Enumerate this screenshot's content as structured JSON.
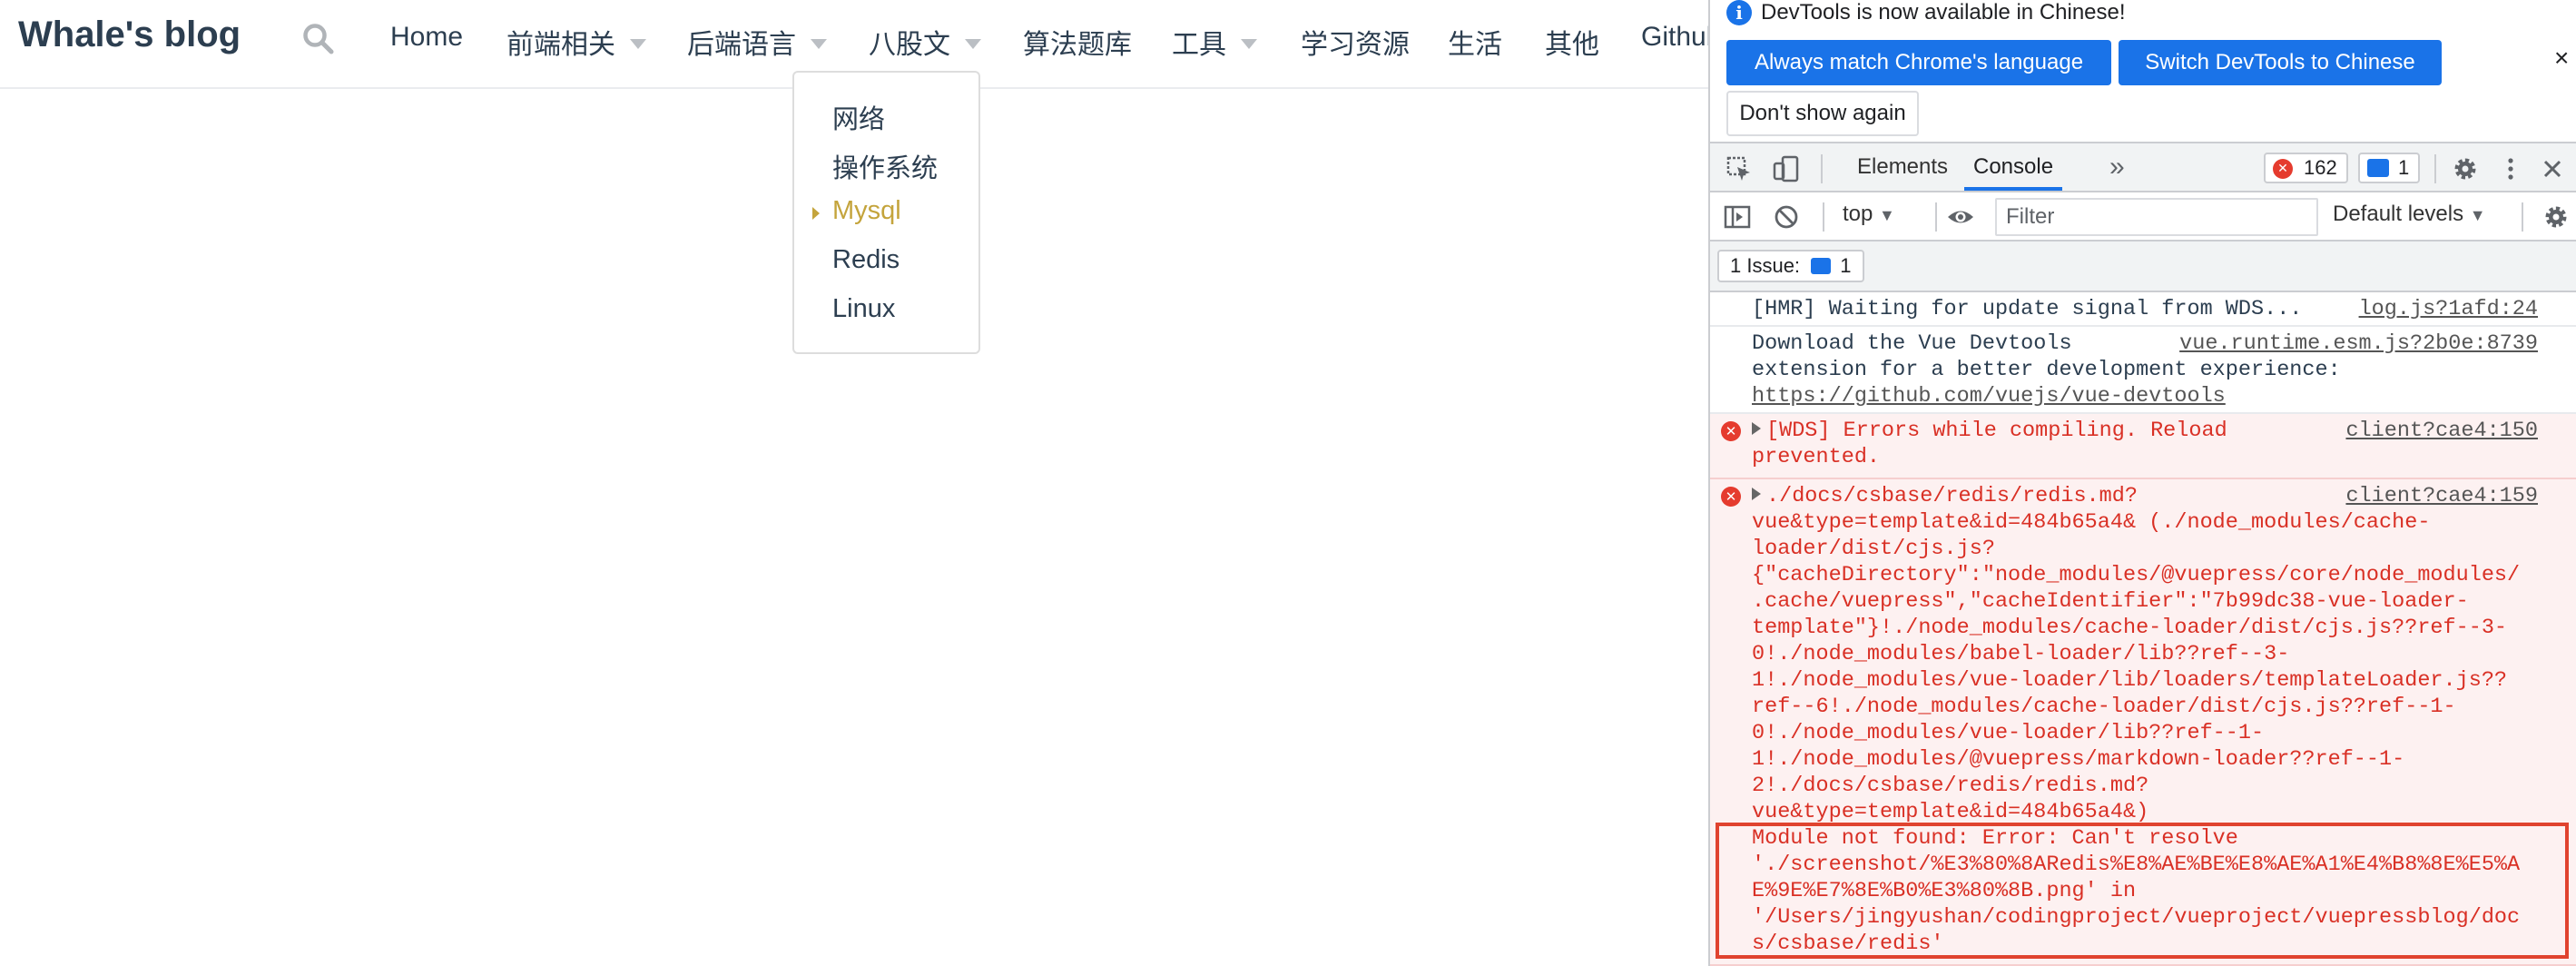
{
  "blog": {
    "site_name": "Whale's blog",
    "nav": [
      {
        "label": "Home"
      },
      {
        "label": "前端相关"
      },
      {
        "label": "后端语言"
      },
      {
        "label": "八股文"
      },
      {
        "label": "算法题库"
      },
      {
        "label": "工具"
      },
      {
        "label": "学习资源"
      },
      {
        "label": "生活"
      },
      {
        "label": "其他"
      },
      {
        "label": "Github"
      }
    ],
    "dropdown": [
      {
        "label": "网络"
      },
      {
        "label": "操作系统"
      },
      {
        "label": "Mysql",
        "active": true
      },
      {
        "label": "Redis"
      },
      {
        "label": "Linux"
      }
    ],
    "accent_color": "#c4a43c"
  },
  "devtools": {
    "infobar": {
      "message": "DevTools is now available in Chinese!",
      "btn_match": "Always match Chrome's language",
      "btn_switch": "Switch DevTools to Chinese",
      "btn_dont_show": "Don't show again",
      "close": "×"
    },
    "tabs": {
      "elements": "Elements",
      "console": "Console",
      "more": "»",
      "errors_count": "162",
      "messages_count": "1"
    },
    "toolbar": {
      "context": "top",
      "filter_placeholder": "Filter",
      "levels": "Default levels"
    },
    "issues": {
      "label": "1 Issue:",
      "count": "1"
    },
    "console": [
      {
        "type": "log",
        "lines": [
          "[HMR] Waiting for update signal from WDS..."
        ],
        "source": "log.js?1afd:24"
      },
      {
        "type": "log",
        "lines": [
          "Download the Vue Devtools",
          "extension for a better development experience:"
        ],
        "link": "https://github.com/vuejs/vue-devtools",
        "source": "vue.runtime.esm.js?2b0e:8739"
      },
      {
        "type": "error",
        "lines": [
          "[WDS] Errors while compiling. Reload",
          "prevented."
        ],
        "source": "client?cae4:150"
      },
      {
        "type": "error",
        "lines": [
          "./docs/csbase/redis/redis.md?",
          "vue&type=template&id=484b65a4& (./node_modules/cache-",
          "loader/dist/cjs.js?",
          "{\"cacheDirectory\":\"node_modules/@vuepress/core/node_modules/",
          ".cache/vuepress\",\"cacheIdentifier\":\"7b99dc38-vue-loader-",
          "template\"}!./node_modules/cache-loader/dist/cjs.js??ref--3-",
          "0!./node_modules/babel-loader/lib??ref--3-",
          "1!./node_modules/vue-loader/lib/loaders/templateLoader.js??",
          "ref--6!./node_modules/cache-loader/dist/cjs.js??ref--1-",
          "0!./node_modules/vue-loader/lib??ref--1-",
          "1!./node_modules/@vuepress/markdown-loader??ref--1-",
          "2!./docs/csbase/redis/redis.md?",
          "vue&type=template&id=484b65a4&)",
          "Module not found: Error: Can't resolve",
          "'./screenshot/%E3%80%8ARedis%E8%AE%BE%E8%AE%A1%E4%B8%8E%E5%A",
          "E%9E%E7%8E%B0%E3%80%8B.png' in",
          "'/Users/jingyushan/codingproject/vueproject/vuepressblog/doc",
          "s/csbase/redis'"
        ],
        "source": "client?cae4:159"
      }
    ]
  }
}
